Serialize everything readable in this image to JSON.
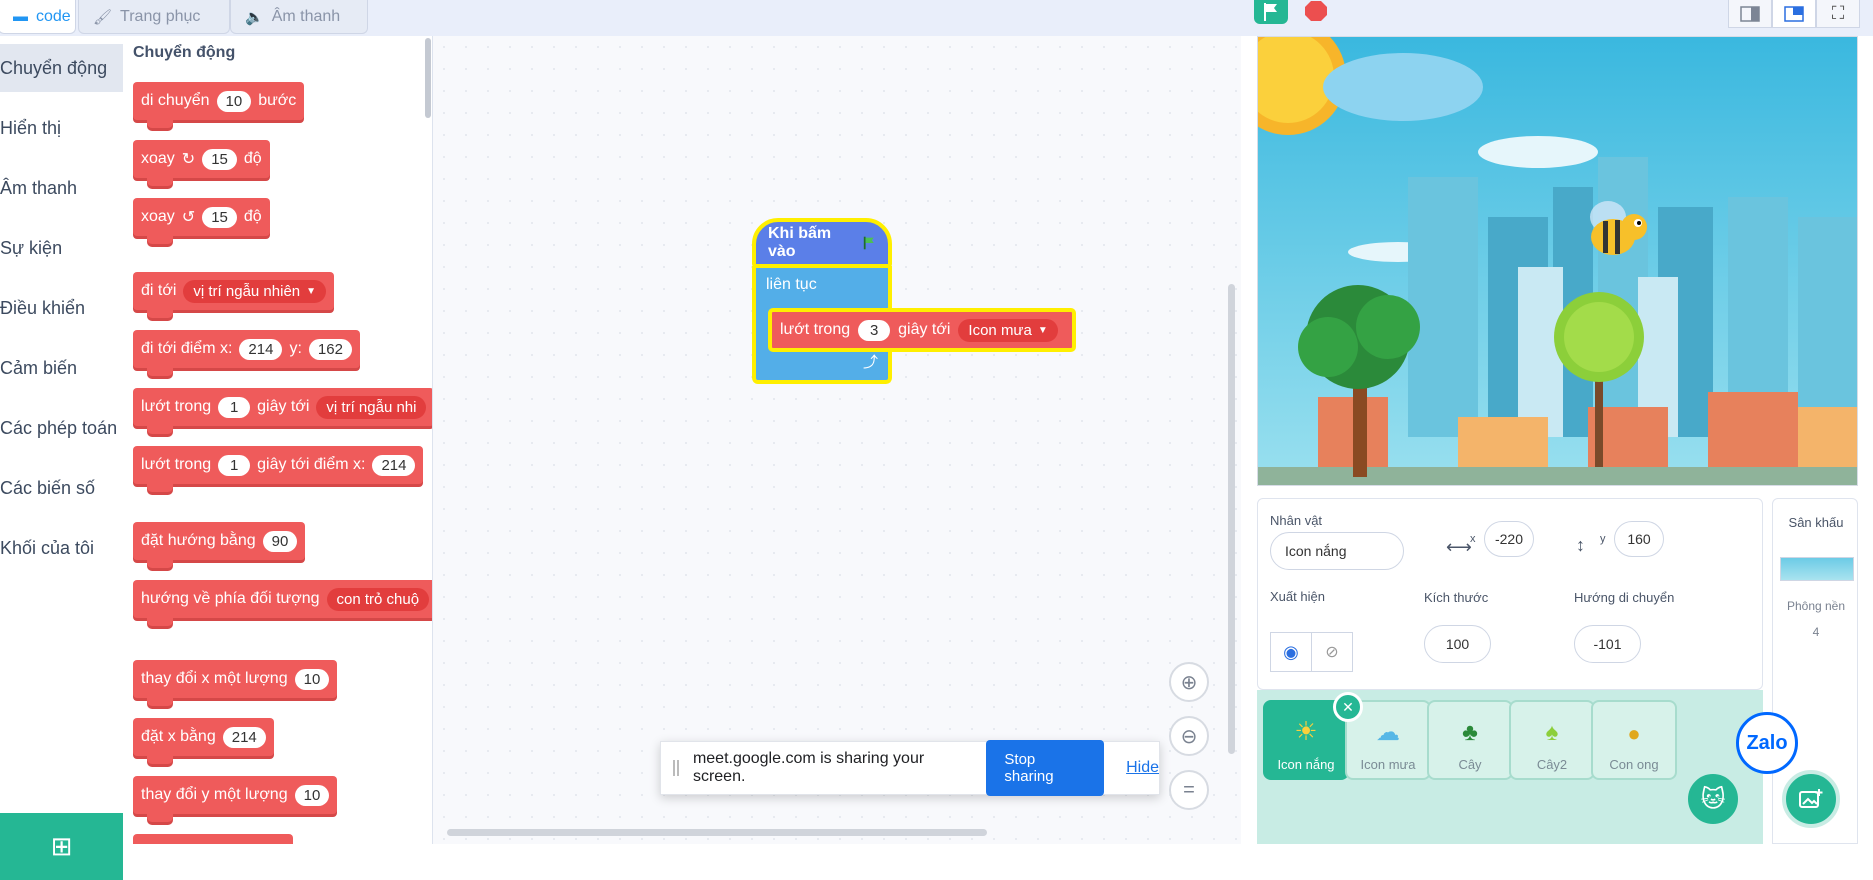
{
  "tabs": [
    {
      "label": "code",
      "icon": "code-icon"
    },
    {
      "label": "Trang phục",
      "icon": "brush-icon"
    },
    {
      "label": "Âm thanh",
      "icon": "speaker-icon"
    }
  ],
  "categories": [
    "Chuyển động",
    "Hiển thị",
    "Âm thanh",
    "Sự kiện",
    "Điều khiển",
    "Cảm biến",
    "Các phép toán",
    "Các biến số",
    "Khối của tôi"
  ],
  "palette": {
    "title": "Chuyển động",
    "blocks": {
      "move": {
        "a": "di chuyển",
        "v": "10",
        "b": "bước"
      },
      "turn_right": {
        "a": "xoay",
        "v": "15",
        "b": "độ"
      },
      "turn_left": {
        "a": "xoay",
        "v": "15",
        "b": "độ"
      },
      "goto": {
        "a": "đi tới",
        "dd": "vị trí ngẫu nhiên"
      },
      "goto_xy": {
        "a": "đi tới điểm x:",
        "x": "214",
        "b": "y:",
        "y": "162"
      },
      "glide": {
        "a": "lướt trong",
        "v": "1",
        "b": "giây tới",
        "dd": "vị trí ngẫu nhi"
      },
      "glide_xy": {
        "a": "lướt trong",
        "v": "1",
        "b": "giây tới điểm x:",
        "x": "214"
      },
      "point_dir": {
        "a": "đặt hướng bằng",
        "v": "90"
      },
      "point_towards": {
        "a": "hướng về phía đối tượng",
        "dd": "con trỏ chuộ"
      },
      "change_x": {
        "a": "thay đổi x một lượng",
        "v": "10"
      },
      "set_x": {
        "a": "đặt x bằng",
        "v": "214"
      },
      "change_y": {
        "a": "thay đổi y một lượng",
        "v": "10"
      }
    }
  },
  "script": {
    "hat": "Khi bấm vào",
    "loop": "liên tục",
    "glide": {
      "a": "lướt trong",
      "v": "3",
      "b": "giây tới",
      "dd": "Icon mưa"
    }
  },
  "share_bar": {
    "text": "meet.google.com is sharing your screen.",
    "stop": "Stop sharing",
    "hide": "Hide"
  },
  "sprite_info": {
    "name_label": "Nhân vật",
    "name": "Icon nắng",
    "x_label": "x",
    "x": "-220",
    "y_label": "y",
    "y": "160",
    "show_label": "Xuất hiện",
    "size_label": "Kích thước",
    "size": "100",
    "dir_label": "Hướng di chuyển",
    "direction": "-101"
  },
  "sprites": [
    {
      "name": "Icon nắng",
      "selected": true
    },
    {
      "name": "Icon mưa",
      "selected": false
    },
    {
      "name": "Cây",
      "selected": false
    },
    {
      "name": "Cây2",
      "selected": false
    },
    {
      "name": "Con ong",
      "selected": false
    }
  ],
  "backdrop": {
    "title": "Sân khấu",
    "label": "Phông nền",
    "count": "4"
  },
  "zalo": "Zalo",
  "colors": {
    "accent": "#25b794",
    "motion": "#ef5b5b",
    "events": "#5b7fe8",
    "control": "#53aee8",
    "highlight": "#ffef00"
  }
}
